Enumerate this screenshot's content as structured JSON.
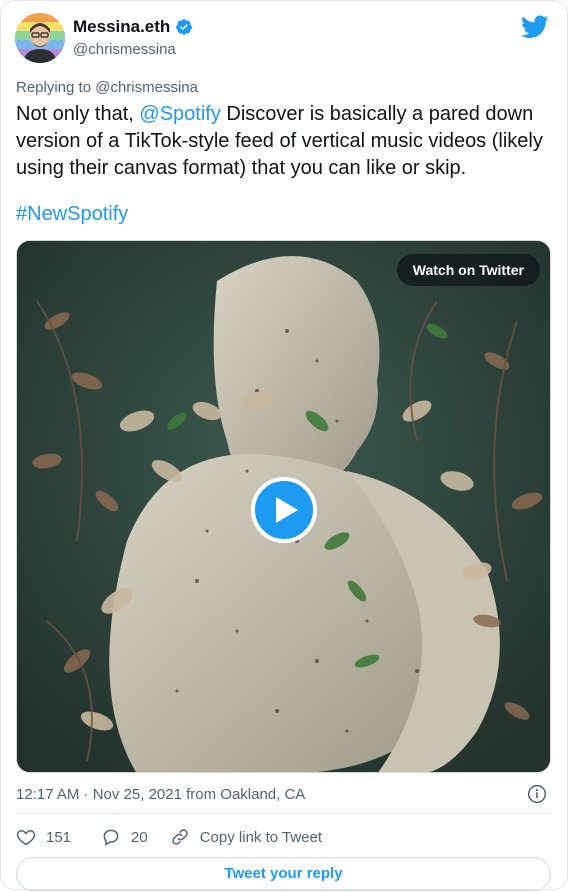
{
  "author": {
    "name": "Messina.eth",
    "handle": "@chrismessina"
  },
  "reply_context": {
    "prefix": "Replying to ",
    "handle": "@chrismessina"
  },
  "tweet": {
    "text_before": "Not only that, ",
    "mention": "@Spotify",
    "text_after": " Discover is basically a pared down version of a TikTok-style feed of vertical music videos (likely using their canvas format) that you can like or skip.",
    "hashtag": "#NewSpotify"
  },
  "media": {
    "watch_label": "Watch on Twitter"
  },
  "meta": {
    "timestamp": "12:17 AM · Nov 25, 2021 from Oakland, CA"
  },
  "actions": {
    "likes": "151",
    "replies": "20",
    "copy_link": "Copy link to Tweet"
  },
  "reply_button": "Tweet your reply",
  "colors": {
    "accent": "#1d9bf0",
    "text": "#0f1419",
    "muted": "#536471"
  },
  "icons": [
    "twitter-bird-icon",
    "verified-badge-icon",
    "play-icon",
    "info-icon",
    "heart-icon",
    "reply-icon",
    "link-icon"
  ]
}
